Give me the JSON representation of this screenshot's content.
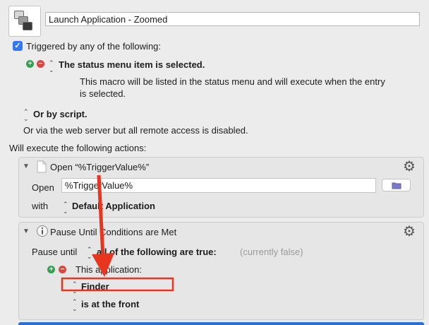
{
  "macro": {
    "name": "Launch Application - Zoomed"
  },
  "trigger": {
    "checkbox_label": "Triggered by any of the following:",
    "status_menu_label": "The status menu item is selected.",
    "status_menu_desc_line1": "This macro will be listed in the status menu and will execute when the entry",
    "status_menu_desc_line2": "is selected.",
    "or_by_script": "Or by script.",
    "web_server_note": "Or via the web server but all remote access is disabled."
  },
  "actions_header": "Will execute the following actions:",
  "action1": {
    "title": "Open “%TriggerValue%”",
    "open_label": "Open",
    "open_value": "%TriggerValue%",
    "with_label": "with",
    "with_value": "Default Application"
  },
  "action2": {
    "title": "Pause Until Conditions are Met",
    "pause_label": "Pause until",
    "condition_mode": "all of the following are true:",
    "status": "(currently false)",
    "condition_type": "This application:",
    "app_value": "Finder",
    "state_value": "is at the front"
  },
  "annotation": {
    "color": "#e8351f"
  },
  "icons": [
    "macro-icon",
    "check-icon",
    "plus-icon",
    "minus-icon",
    "chevron-updown-icon",
    "gear-icon",
    "disclosure-triangle-icon",
    "document-icon",
    "info-icon",
    "folder-icon",
    "arrow-icon"
  ]
}
